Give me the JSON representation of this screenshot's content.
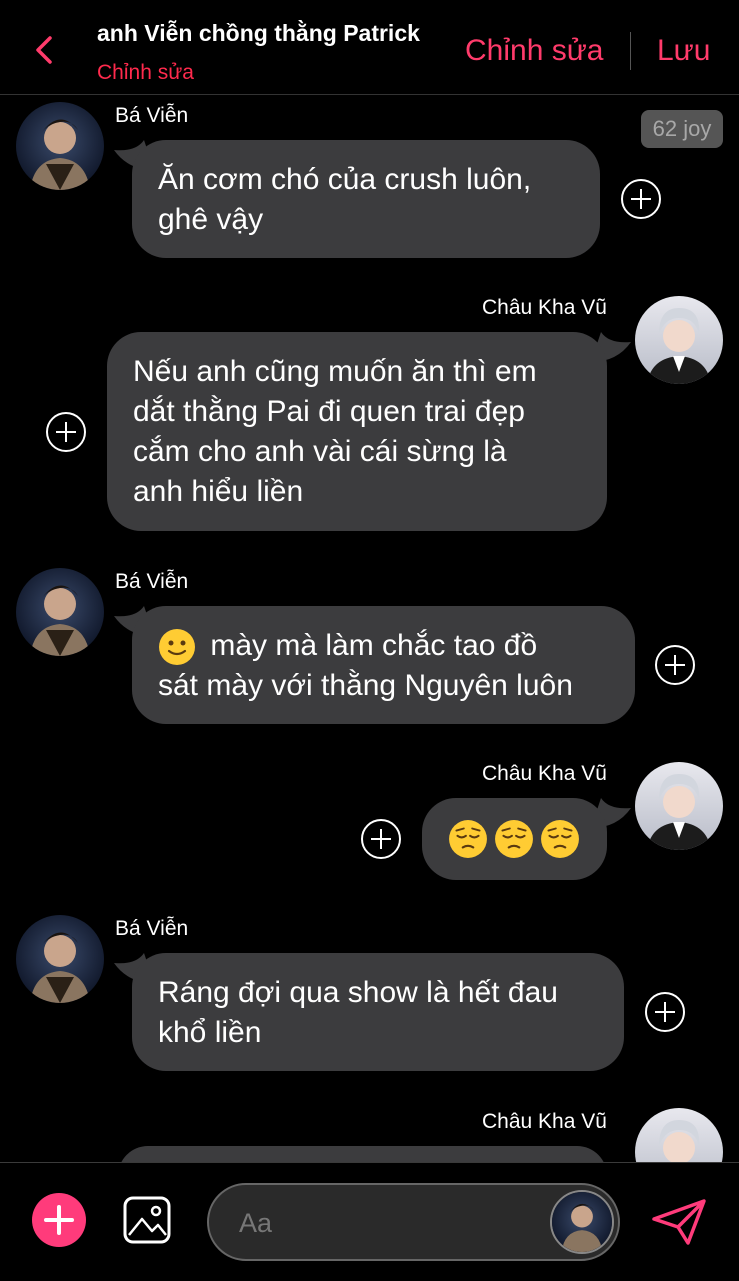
{
  "header": {
    "title": "anh Viễn chồng thằng Patrick",
    "subtitle": "Chỉnh sửa",
    "edit_label": "Chỉnh sửa",
    "save_label": "Lưu"
  },
  "colors": {
    "accent": "#ff3b6b",
    "bubble": "#3c3c3e",
    "background": "#000000"
  },
  "badge": {
    "joy": "62 joy"
  },
  "messages": [
    {
      "sender": "Bá Viễn",
      "side": "left",
      "text": "Ăn cơm chó của crush luôn,\nghê vậy"
    },
    {
      "sender": "Châu Kha Vũ",
      "side": "right",
      "text": "Nếu anh cũng muốn ăn thì em\ndắt thằng Pai đi quen trai đẹp\ncắm cho anh vài cái sừng là\nanh hiểu liền"
    },
    {
      "sender": "Bá Viễn",
      "side": "left",
      "text": " mày mà làm chắc tao đồ\nsát mày với thằng Nguyên luôn",
      "emoji": "slightly-smiling-face"
    },
    {
      "sender": "Châu Kha Vũ",
      "side": "right",
      "emoji": "pensive-face x3"
    },
    {
      "sender": "Bá Viễn",
      "side": "left",
      "text": "Ráng đợi qua show là hết đau\nkhổ liền"
    },
    {
      "sender": "Châu Kha Vũ",
      "side": "right",
      "text": ""
    }
  ],
  "composer": {
    "placeholder": "Aa"
  },
  "icons": {
    "back": "chevron-left-icon",
    "add": "plus-icon",
    "image": "image-icon",
    "send": "send-icon",
    "react": "plus-circle-icon"
  }
}
